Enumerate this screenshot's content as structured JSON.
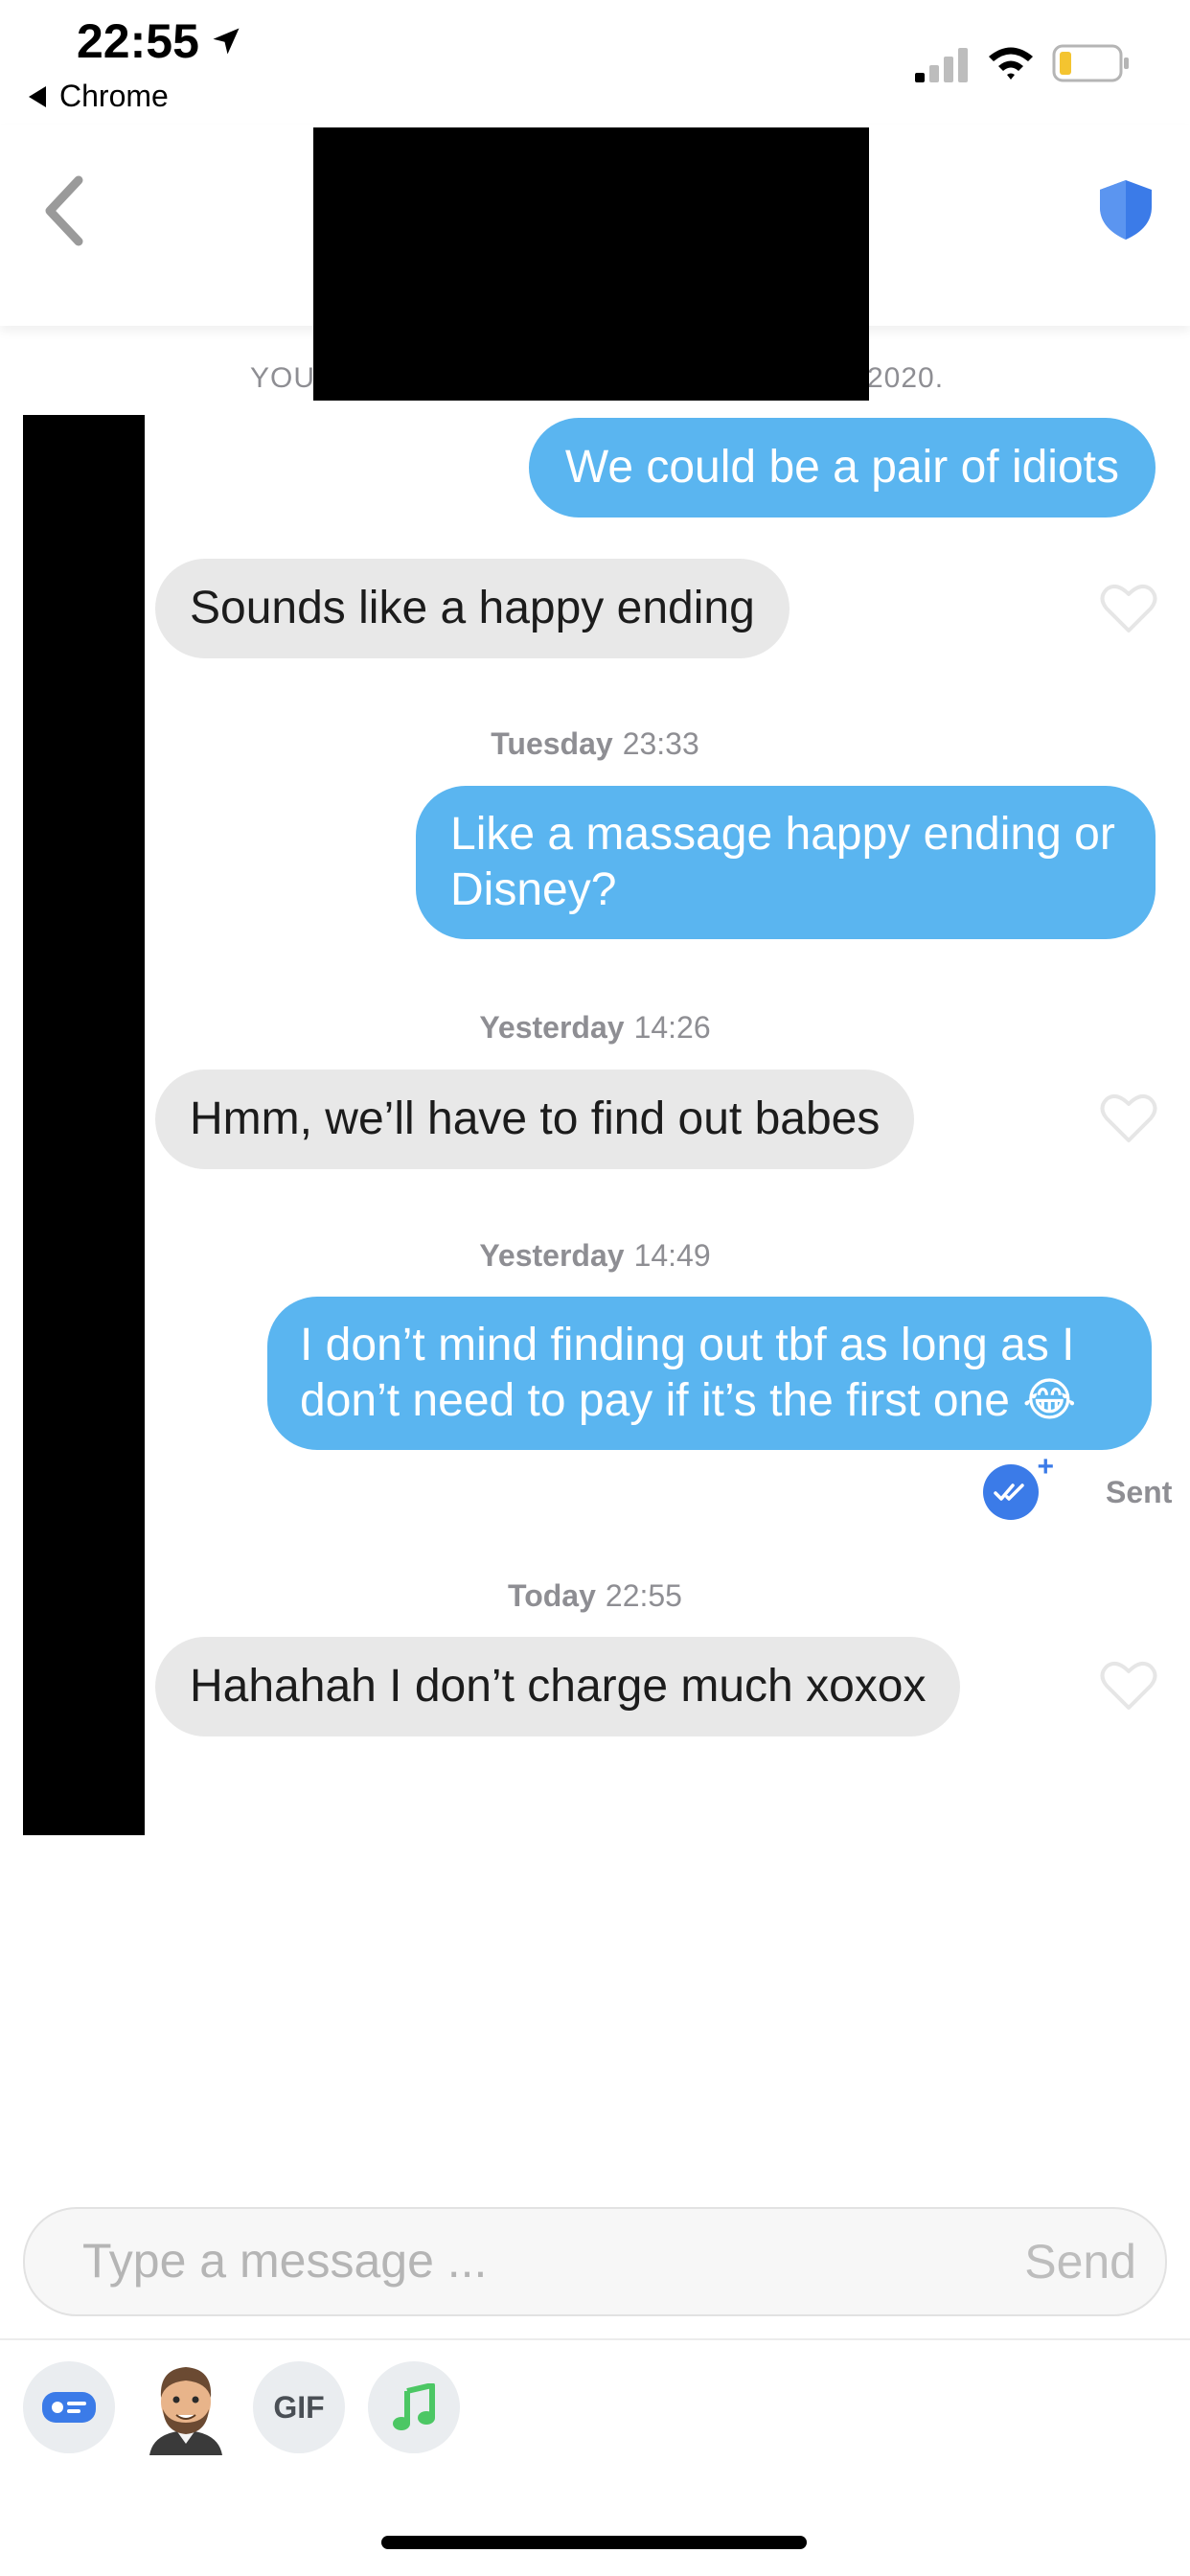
{
  "status_bar": {
    "time": "22:55",
    "back_app": "Chrome"
  },
  "header": {
    "match_note_start": "YOU",
    "match_note_end": "2020."
  },
  "messages": [
    {
      "direction": "out",
      "text": "We could be a pair of idiots"
    },
    {
      "direction": "in",
      "text": "Sounds like a happy ending"
    },
    {
      "direction": "out",
      "day": "Tuesday",
      "time": "23:33",
      "text": "Like a massage happy ending or Disney?"
    },
    {
      "direction": "in",
      "day": "Yesterday",
      "time": "14:26",
      "text": "Hmm, we’ll have to find out babes"
    },
    {
      "direction": "out",
      "day": "Yesterday",
      "time": "14:49",
      "text": "I don’t mind finding out tbf as long as I don’t need to pay if it’s the first one",
      "emoji": "😂",
      "status": "Sent"
    },
    {
      "direction": "in",
      "day": "Today",
      "time": "22:55",
      "text": "Hahahah I don’t charge much xoxox"
    }
  ],
  "composer": {
    "placeholder": "Type a message ...",
    "send_label": "Send"
  },
  "toolbar": {
    "gif_label": "GIF"
  },
  "colors": {
    "outgoing_bubble": "#5ab5f0",
    "incoming_bubble": "#e8e8e8",
    "shield": "#3b7be8"
  }
}
